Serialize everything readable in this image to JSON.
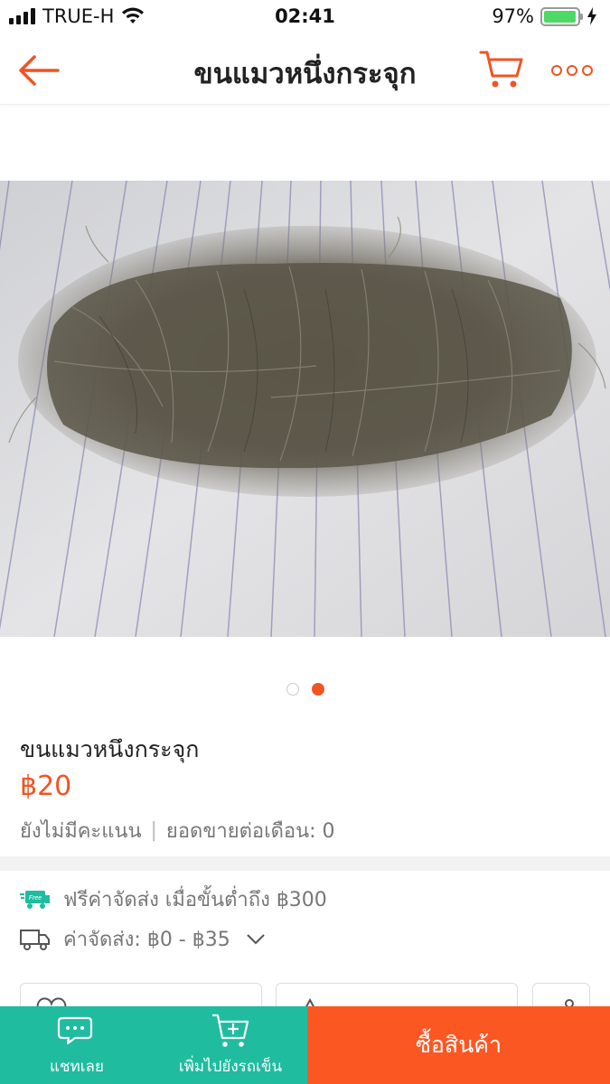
{
  "status_bar": {
    "carrier": "TRUE-H",
    "time": "02:41",
    "battery_percent": "97%",
    "battery_level": 0.97
  },
  "header": {
    "title": "ขนแมวหนึ่งกระจุก",
    "back_icon": "back-arrow-icon",
    "cart_icon": "cart-icon",
    "more_icon": "more-dots-icon",
    "accent_color": "#f05423"
  },
  "gallery": {
    "image_description_icon": "product-photo",
    "dots": [
      {
        "active": false
      },
      {
        "active": true
      }
    ]
  },
  "product": {
    "name": "ขนแมวหนึงกระจุก",
    "price": "฿20",
    "rating_text": "ยังไม่มีคะแนน",
    "separator": "|",
    "sales_text": "ยอดขายต่อเดือน: 0"
  },
  "shipping": {
    "free_badge": "Free",
    "free_text": "ฟรีค่าจัดส่ง เมื่อขั้นต่ำถึง ฿300",
    "cost_text": "ค่าจัดส่ง: ฿0 - ฿35"
  },
  "bottom_bar": {
    "chat_label": "แชทเลย",
    "add_cart_label": "เพิ่มไปยังรถเข็น",
    "buy_label": "ซื้อสินค้า",
    "chat_color": "#1fbca0",
    "buy_color": "#fb5722"
  }
}
